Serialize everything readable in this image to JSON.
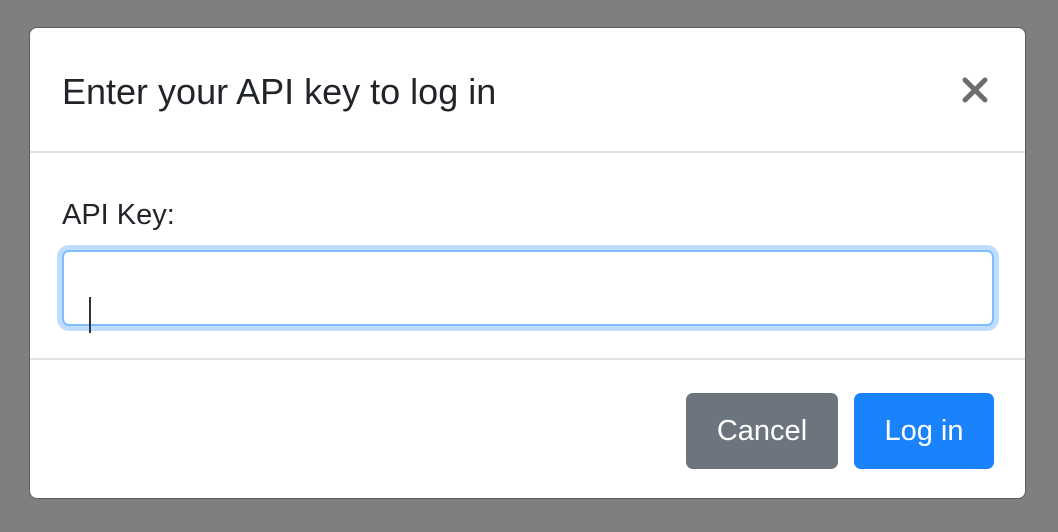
{
  "modal": {
    "title": "Enter your API key to log in",
    "close_icon": "close-x-icon"
  },
  "form": {
    "api_key_label": "API Key:",
    "api_key_value": "",
    "api_key_placeholder": ""
  },
  "footer": {
    "cancel_label": "Cancel",
    "login_label": "Log in"
  },
  "colors": {
    "overlay": "#7f7f7f",
    "primary": "#1a82fb",
    "secondary": "#6c757d",
    "focus_border": "#80bdff",
    "text": "#212529"
  }
}
